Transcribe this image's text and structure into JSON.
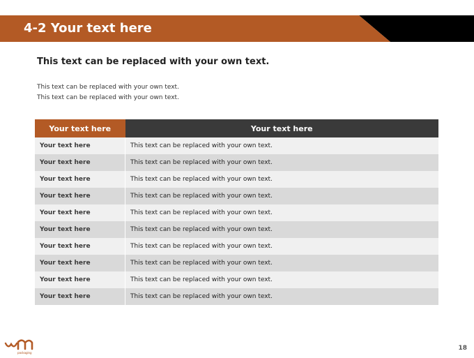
{
  "header": {
    "title": "4-2 Your text here",
    "band_color": "#b35a25",
    "accent_color": "#000000"
  },
  "subtitle": "This text can be replaced with your own text.",
  "body_lines": [
    "This text can be replaced with your own text.",
    "This text can be replaced with your own text."
  ],
  "table": {
    "headers": [
      "Your text here",
      "Your text here"
    ],
    "rows": [
      [
        "Your text here",
        "This text can be replaced with your own text."
      ],
      [
        "Your text here",
        "This text can be replaced with your own text."
      ],
      [
        "Your text here",
        "This text can be replaced with your own text."
      ],
      [
        "Your text here",
        "This text can be replaced with your own text."
      ],
      [
        "Your text here",
        "This text can be replaced with your own text."
      ],
      [
        "Your text here",
        "This text can be replaced with your own text."
      ],
      [
        "Your text here",
        "This text can be replaced with your own text."
      ],
      [
        "Your text here",
        "This text can be replaced with your own text."
      ],
      [
        "Your text here",
        "This text can be replaced with your own text."
      ],
      [
        "Your text here",
        "This text can be replaced with your own text."
      ]
    ]
  },
  "footer": {
    "logo_text": "packaging",
    "page_number": "18"
  }
}
